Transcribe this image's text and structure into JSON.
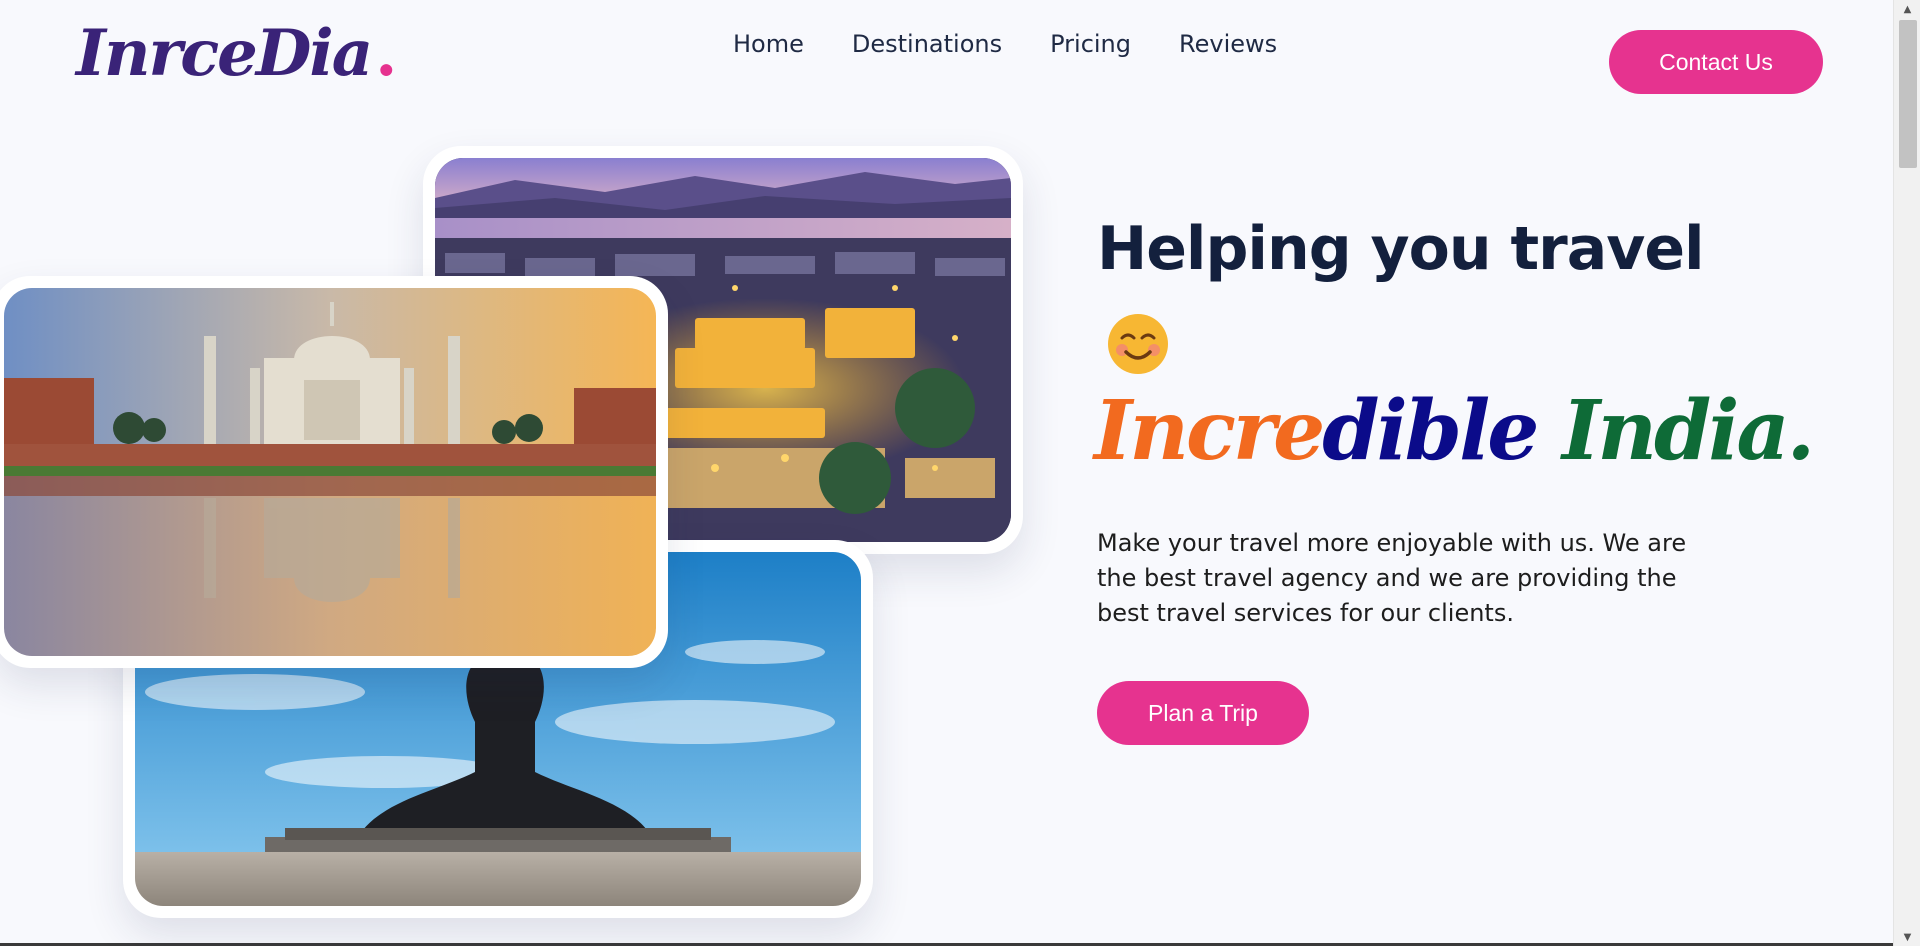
{
  "header": {
    "logo_text": "InrceDia",
    "logo_dot": ".",
    "nav": [
      "Home",
      "Destinations",
      "Pricing",
      "Reviews"
    ],
    "contact_label": "Contact Us"
  },
  "hero": {
    "title": "Helping you travel",
    "emoji_icon": "smiling-face-icon",
    "brand_part1": "Incre",
    "brand_part2": "dible",
    "brand_part3": "India.",
    "description": "Make your travel more enjoyable with us. We are the best travel agency and we are providing the best travel services for our clients.",
    "cta_label": "Plan a Trip"
  },
  "images": {
    "taj": "taj-mahal-photo",
    "city": "lake-city-night-photo",
    "statue": "adiyogi-statue-photo"
  },
  "colors": {
    "accent": "#e6338f",
    "logo": "#3a2378",
    "saffron": "#f26a1f",
    "navy": "#0b0b8a",
    "green": "#0e6b37",
    "heading": "#13203d",
    "background": "#f8f9fd"
  }
}
